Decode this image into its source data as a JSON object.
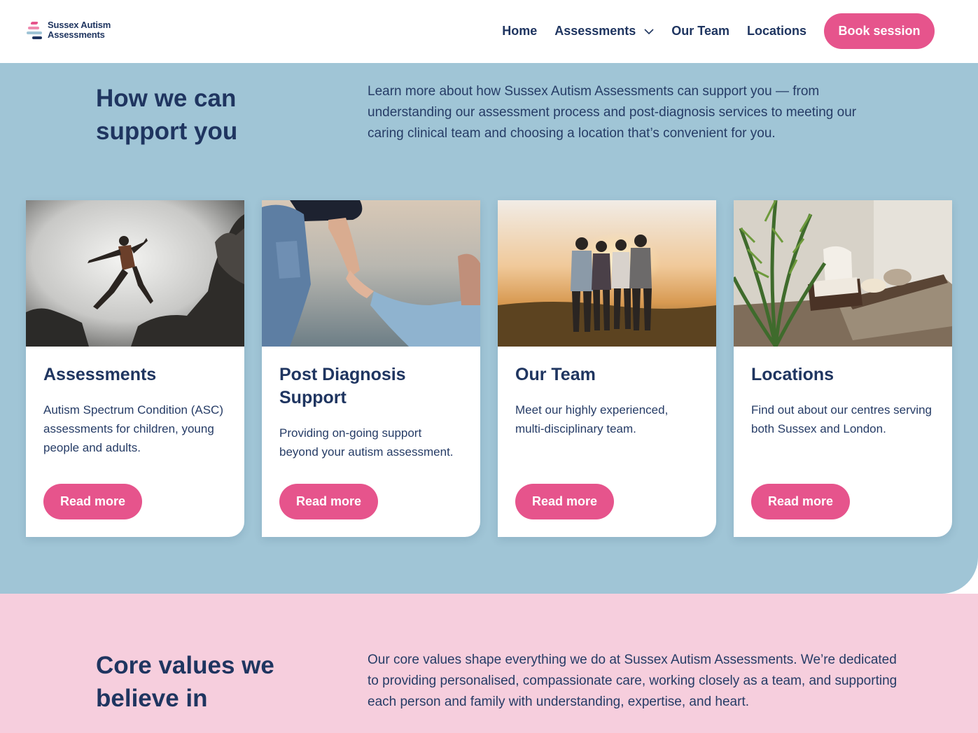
{
  "brand": {
    "name_line1": "Sussex Autism",
    "name_line2": "Assessments"
  },
  "nav": {
    "items": [
      {
        "label": "Home"
      },
      {
        "label": "Assessments",
        "icon": "chevron-down-icon"
      },
      {
        "label": "Our Team"
      },
      {
        "label": "Locations"
      }
    ],
    "cta_label": "Book session"
  },
  "support": {
    "title": "How we can support you",
    "intro": "Learn more about how Sussex Autism Assessments can support you — from understanding our assessment process and post-diagnosis services to meeting our caring clinical team and choosing a location that’s convenient for you.",
    "cards": [
      {
        "title": "Assessments",
        "description": "Autism Spectrum Condition (ASC) assessments for children, young people and adults.",
        "button": "Read more",
        "image": "person-jumping-between-rocks-photo"
      },
      {
        "title": "Post Diagnosis Support",
        "description": "Providing on-going support beyond your autism assessment.",
        "button": "Read more",
        "image": "adult-holding-child-hand-photo"
      },
      {
        "title": "Our Team",
        "description": "Meet our highly experienced, multi-disciplinary team.",
        "button": "Read more",
        "image": "group-at-sunset-photo"
      },
      {
        "title": "Locations",
        "description": "Find out about our centres serving both Sussex and London.",
        "button": "Read more",
        "image": "clinic-room-with-plant-photo"
      }
    ]
  },
  "values": {
    "title": "Core values we believe in",
    "intro": "Our core values shape everything we do at Sussex Autism Assessments. We’re dedicated to providing personalised, compassionate care, working closely as a team, and supporting each person and family with understanding, expertise, and heart."
  },
  "colors": {
    "navy": "#1f3560",
    "pink": "#e6548c",
    "blue_bg": "#a0c5d6",
    "pink_bg": "#f6cedd"
  }
}
